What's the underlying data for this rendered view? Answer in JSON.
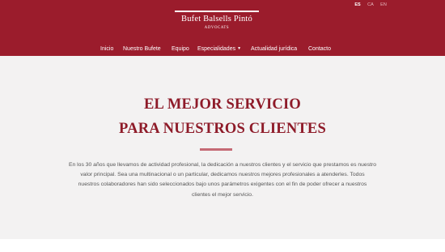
{
  "languages": [
    {
      "code": "ES",
      "active": true
    },
    {
      "code": "CA",
      "active": false
    },
    {
      "code": "EN",
      "active": false
    }
  ],
  "logo": {
    "name": "Bufet Balsells Pintó",
    "subtitle": "ADVOCATS"
  },
  "nav": {
    "items": [
      {
        "label": "Inicio"
      },
      {
        "label": "Nuestro Bufete"
      },
      {
        "label": "Equipo"
      },
      {
        "label": "Especialidades",
        "has_dropdown": true,
        "dropdown_icon": "chevron-down-icon"
      },
      {
        "label": "Actualidad jurídica"
      },
      {
        "label": "Contacto"
      }
    ]
  },
  "hero": {
    "headline_line1": "EL MEJOR SERVICIO",
    "headline_line2": "PARA NUESTROS CLIENTES",
    "intro_lines": [
      "En los 30 años que llevamos de actividad profesional, la dedicación a nuestros clientes y el servicio que prestamos es nuestro",
      "valor principal. Sea una multinacional o un particular, dedicamos nuestros mejores profesionales a atenderles. Todos",
      "nuestros colaboradores han sido seleccionados bajo unos parámetros exigentes con el fin de poder ofrecer a nuestros",
      "clientes el mejor servicio."
    ]
  },
  "colors": {
    "brand": "#9b1c2c",
    "headline": "#8e1b29",
    "divider": "#c56a75",
    "hero_background": "#f3f2f2",
    "body_text": "#555555"
  }
}
